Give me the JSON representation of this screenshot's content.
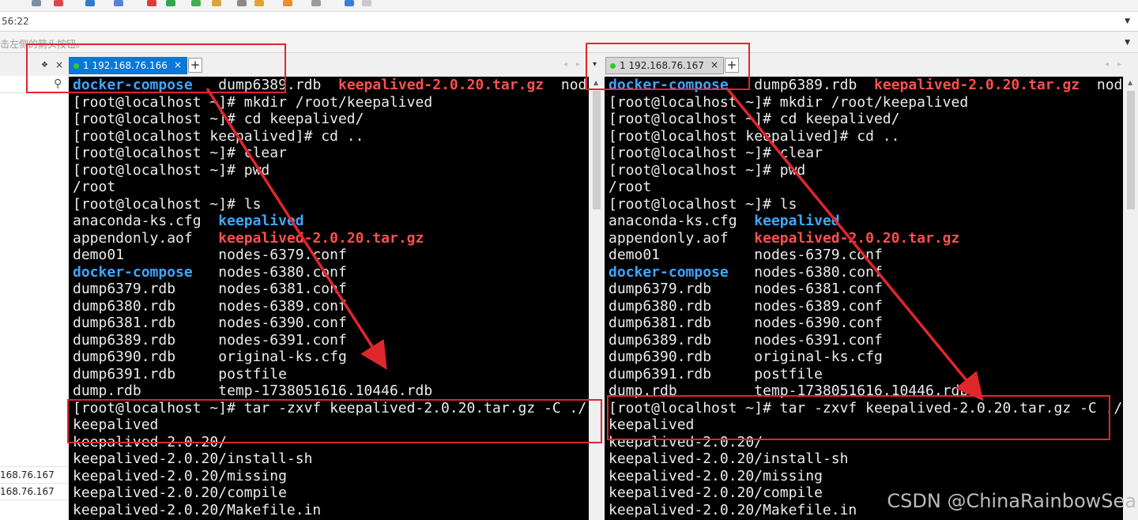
{
  "window": {
    "time_text": "56:22",
    "hint_text": "击左侧的箭头按钮。"
  },
  "left_panel": {
    "pin_glyph": "❖",
    "close_glyph": "×",
    "search_glyph": "⚲",
    "sessions": [
      "168.76.167",
      "168.76.167"
    ]
  },
  "panes": [
    {
      "tab": {
        "label": "1 192.168.76.166",
        "state": "active",
        "close": "×",
        "new_tab": "+"
      },
      "lines": [
        [
          {
            "t": "docker-compose",
            "s": "blue",
            "c": 0
          },
          {
            "t": "dump6389.rdb",
            "s": "",
            "c": 17
          },
          {
            "t": "keepalived-2.0.20.tar.gz",
            "s": "red",
            "c": 31
          },
          {
            "t": "nod",
            "s": "",
            "c": 57
          }
        ],
        [
          {
            "t": "[root@localhost ~]# mkdir /root/keepalived",
            "s": "",
            "c": 0
          }
        ],
        [
          {
            "t": "[root@localhost ~]# cd keepalived/",
            "s": "",
            "c": 0
          }
        ],
        [
          {
            "t": "[root@localhost keepalived]# cd ..",
            "s": "",
            "c": 0
          }
        ],
        [
          {
            "t": "[root@localhost ~]# clear",
            "s": "",
            "c": 0
          }
        ],
        [
          {
            "t": "[root@localhost ~]# pwd",
            "s": "",
            "c": 0
          }
        ],
        [
          {
            "t": "/root",
            "s": "",
            "c": 0
          }
        ],
        [
          {
            "t": "[root@localhost ~]# ls",
            "s": "",
            "c": 0
          }
        ],
        [
          {
            "t": "anaconda-ks.cfg",
            "s": "",
            "c": 0
          },
          {
            "t": "keepalived",
            "s": "blue",
            "c": 17
          }
        ],
        [
          {
            "t": "appendonly.aof",
            "s": "",
            "c": 0
          },
          {
            "t": "keepalived-2.0.20.tar.gz",
            "s": "red",
            "c": 17
          }
        ],
        [
          {
            "t": "demo01",
            "s": "",
            "c": 0
          },
          {
            "t": "nodes-6379.conf",
            "s": "",
            "c": 17
          }
        ],
        [
          {
            "t": "docker-compose",
            "s": "blue",
            "c": 0
          },
          {
            "t": "nodes-6380.conf",
            "s": "",
            "c": 17
          }
        ],
        [
          {
            "t": "dump6379.rdb",
            "s": "",
            "c": 0
          },
          {
            "t": "nodes-6381.conf",
            "s": "",
            "c": 17
          }
        ],
        [
          {
            "t": "dump6380.rdb",
            "s": "",
            "c": 0
          },
          {
            "t": "nodes-6389.conf",
            "s": "",
            "c": 17
          }
        ],
        [
          {
            "t": "dump6381.rdb",
            "s": "",
            "c": 0
          },
          {
            "t": "nodes-6390.conf",
            "s": "",
            "c": 17
          }
        ],
        [
          {
            "t": "dump6389.rdb",
            "s": "",
            "c": 0
          },
          {
            "t": "nodes-6391.conf",
            "s": "",
            "c": 17
          }
        ],
        [
          {
            "t": "dump6390.rdb",
            "s": "",
            "c": 0
          },
          {
            "t": "original-ks.cfg",
            "s": "",
            "c": 17
          }
        ],
        [
          {
            "t": "dump6391.rdb",
            "s": "",
            "c": 0
          },
          {
            "t": "postfile",
            "s": "",
            "c": 17
          }
        ],
        [
          {
            "t": "dump.rdb",
            "s": "",
            "c": 0
          },
          {
            "t": "temp-1738051616.10446.rdb",
            "s": "",
            "c": 17
          }
        ],
        [
          {
            "t": "[root@localhost ~]# tar -zxvf keepalived-2.0.20.tar.gz -C ./",
            "s": "",
            "c": 0
          }
        ],
        [
          {
            "t": "keepalived",
            "s": "",
            "c": 0
          }
        ],
        [
          {
            "t": "keepalived-2.0.20/",
            "s": "",
            "c": 0
          }
        ],
        [
          {
            "t": "keepalived-2.0.20/install-sh",
            "s": "",
            "c": 0
          }
        ],
        [
          {
            "t": "keepalived-2.0.20/missing",
            "s": "",
            "c": 0
          }
        ],
        [
          {
            "t": "keepalived-2.0.20/compile",
            "s": "",
            "c": 0
          }
        ],
        [
          {
            "t": "keepalived-2.0.20/Makefile.in",
            "s": "",
            "c": 0
          }
        ]
      ]
    },
    {
      "tab": {
        "label": "1 192.168.76.167",
        "state": "inactive",
        "close": "×",
        "new_tab": "+"
      },
      "lines": [
        [
          {
            "t": "docker-compose",
            "s": "blue",
            "c": 0
          },
          {
            "t": "dump6389.rdb",
            "s": "",
            "c": 17
          },
          {
            "t": "keepalived-2.0.20.tar.gz",
            "s": "red",
            "c": 31
          },
          {
            "t": "nod",
            "s": "",
            "c": 57
          }
        ],
        [
          {
            "t": "[root@localhost ~]# mkdir /root/keepalived",
            "s": "",
            "c": 0
          }
        ],
        [
          {
            "t": "[root@localhost ~]# cd keepalived/",
            "s": "",
            "c": 0
          }
        ],
        [
          {
            "t": "[root@localhost keepalived]# cd ..",
            "s": "",
            "c": 0
          }
        ],
        [
          {
            "t": "[root@localhost ~]# clear",
            "s": "",
            "c": 0
          }
        ],
        [
          {
            "t": "[root@localhost ~]# pwd",
            "s": "",
            "c": 0
          }
        ],
        [
          {
            "t": "/root",
            "s": "",
            "c": 0
          }
        ],
        [
          {
            "t": "[root@localhost ~]# ls",
            "s": "",
            "c": 0
          }
        ],
        [
          {
            "t": "anaconda-ks.cfg",
            "s": "",
            "c": 0
          },
          {
            "t": "keepalived",
            "s": "blue",
            "c": 17
          }
        ],
        [
          {
            "t": "appendonly.aof",
            "s": "",
            "c": 0
          },
          {
            "t": "keepalived-2.0.20.tar.gz",
            "s": "red",
            "c": 17
          }
        ],
        [
          {
            "t": "demo01",
            "s": "",
            "c": 0
          },
          {
            "t": "nodes-6379.conf",
            "s": "",
            "c": 17
          }
        ],
        [
          {
            "t": "docker-compose",
            "s": "blue",
            "c": 0
          },
          {
            "t": "nodes-6380.conf",
            "s": "",
            "c": 17
          }
        ],
        [
          {
            "t": "dump6379.rdb",
            "s": "",
            "c": 0
          },
          {
            "t": "nodes-6381.conf",
            "s": "",
            "c": 17
          }
        ],
        [
          {
            "t": "dump6380.rdb",
            "s": "",
            "c": 0
          },
          {
            "t": "nodes-6389.conf",
            "s": "",
            "c": 17
          }
        ],
        [
          {
            "t": "dump6381.rdb",
            "s": "",
            "c": 0
          },
          {
            "t": "nodes-6390.conf",
            "s": "",
            "c": 17
          }
        ],
        [
          {
            "t": "dump6389.rdb",
            "s": "",
            "c": 0
          },
          {
            "t": "nodes-6391.conf",
            "s": "",
            "c": 17
          }
        ],
        [
          {
            "t": "dump6390.rdb",
            "s": "",
            "c": 0
          },
          {
            "t": "original-ks.cfg",
            "s": "",
            "c": 17
          }
        ],
        [
          {
            "t": "dump6391.rdb",
            "s": "",
            "c": 0
          },
          {
            "t": "postfile",
            "s": "",
            "c": 17
          }
        ],
        [
          {
            "t": "dump.rdb",
            "s": "",
            "c": 0
          },
          {
            "t": "temp-1738051616.10446.rdb",
            "s": "",
            "c": 17
          }
        ],
        [
          {
            "t": "[root@localhost ~]# tar -zxvf keepalived-2.0.20.tar.gz -C ./",
            "s": "",
            "c": 0
          }
        ],
        [
          {
            "t": "keepalived",
            "s": "",
            "c": 0
          }
        ],
        [
          {
            "t": "keepalived-2.0.20/",
            "s": "",
            "c": 0
          }
        ],
        [
          {
            "t": "keepalived-2.0.20/install-sh",
            "s": "",
            "c": 0
          }
        ],
        [
          {
            "t": "keepalived-2.0.20/missing",
            "s": "",
            "c": 0
          }
        ],
        [
          {
            "t": "keepalived-2.0.20/compile",
            "s": "",
            "c": 0
          }
        ],
        [
          {
            "t": "keepalived-2.0.20/Makefile.in",
            "s": "",
            "c": 0
          }
        ]
      ]
    }
  ],
  "watermark": "CSDN @ChinaRainbowSea",
  "colors": {
    "terminal_bg": "#000000",
    "terminal_fg": "#ececec",
    "directory": "#3ea6ff",
    "archive": "#ff4f4f",
    "active_tab": "#0a78d7",
    "annotation": "#e0262d"
  }
}
